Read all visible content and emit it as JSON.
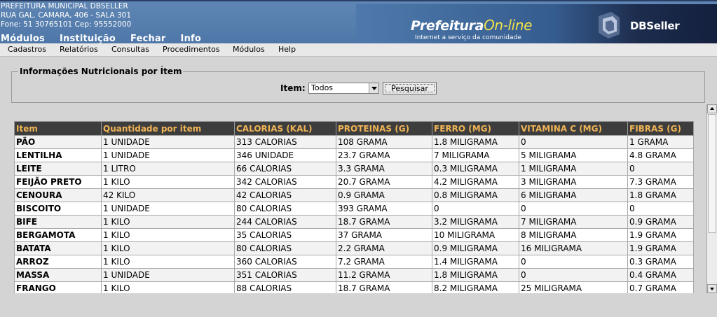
{
  "header": {
    "org_name": "PREFEITURA MUNICIPAL DBSELLER",
    "address": "RUA GAL. CAMARA, 406 - SALA 301",
    "contact": "Fone: 51 30765101   Cep: 95552000",
    "logo_main": "Prefeitura",
    "logo_online": "On-line",
    "logo_subtitle": "Internet a serviço da comunidade",
    "brand": "DBSeller"
  },
  "top_menu": [
    "Módulos",
    "Instituição",
    "Fechar",
    "Info"
  ],
  "menu_bar": [
    "Cadastros",
    "Relatórios",
    "Consultas",
    "Procedimentos",
    "Módulos",
    "Help"
  ],
  "filter": {
    "legend": "Informações Nutricionais por Ítem",
    "item_label": "Item:",
    "item_value": "Todos",
    "search_button": "Pesquisar"
  },
  "table": {
    "columns": [
      "Item",
      "Quantidade por item",
      "CALORIAS (KAL)",
      "PROTEINAS (G)",
      "FERRO (MG)",
      "VITAMINA C (MG)",
      "FIBRAS (G)"
    ],
    "rows": [
      [
        "PÃO",
        "1 UNIDADE",
        "313 CALORIAS",
        "108 GRAMA",
        "1.8 MILIGRAMA",
        "0",
        "1 GRAMA"
      ],
      [
        "LENTILHA",
        "1 UNIDADE",
        "346 UNIDADE",
        "23.7 GRAMA",
        "7 MILIGRAMA",
        "5 MILIGRAMA",
        "4.8 GRAMA"
      ],
      [
        "LEITE",
        "1 LITRO",
        "66 CALORIAS",
        "3.3 GRAMA",
        "0.3 MILIGRAMA",
        "1 MILIGRAMA",
        "0"
      ],
      [
        "FEIJÃO PRETO",
        "1 KILO",
        "342 CALORIAS",
        "20.7 GRAMA",
        "4.2 MILIGRAMA",
        "3 MILIGRAMA",
        "7.3 GRAMA"
      ],
      [
        "CENOURA",
        "42 KILO",
        "42 CALORIAS",
        "0.9 GRAMA",
        "0.8 MILIGRAMA",
        "6 MILIGRAMA",
        "1.8 GRAMA"
      ],
      [
        "BISCOITO",
        "1 UNIDADE",
        "80 CALORIAS",
        "393 GRAMA",
        "0",
        "0",
        "0"
      ],
      [
        "BIFE",
        "1 KILO",
        "244 CALORIAS",
        "18.7 GRAMA",
        "3.2 MILIGRAMA",
        "7 MILIGRAMA",
        "0.9 GRAMA"
      ],
      [
        "BERGAMOTA",
        "1 KILO",
        "35 CALORIAS",
        "37 GRAMA",
        "10 MILIGRAMA",
        "8 MILIGRAMA",
        "1.9 GRAMA"
      ],
      [
        "BATATA",
        "1 KILO",
        "80 CALORIAS",
        "2.2 GRAMA",
        "0.9 MILIGRAMA",
        "16 MILIGRAMA",
        "1.9 GRAMA"
      ],
      [
        "ARROZ",
        "1 KILO",
        "360 CALORIAS",
        "7.2 GRAMA",
        "1.4 MILIGRAMA",
        "0",
        "0.3 GRAMA"
      ],
      [
        "MASSA",
        "1 UNIDADE",
        "351 CALORIAS",
        "11.2 GRAMA",
        "1.8 MILIGRAMA",
        "0",
        "0.4 GRAMA"
      ],
      [
        "FRANGO",
        "1 KILO",
        "88 CALORIAS",
        "18.7 GRAMA",
        "8.2 MILIGRAMA",
        "25 MILIGRAMA",
        "0.7 GRAMA"
      ]
    ]
  },
  "colors": {
    "banner": "#4e77a8",
    "header_bg": "#3d3d3d",
    "header_text": "#f0b457",
    "logo_online": "#f0e24a"
  }
}
